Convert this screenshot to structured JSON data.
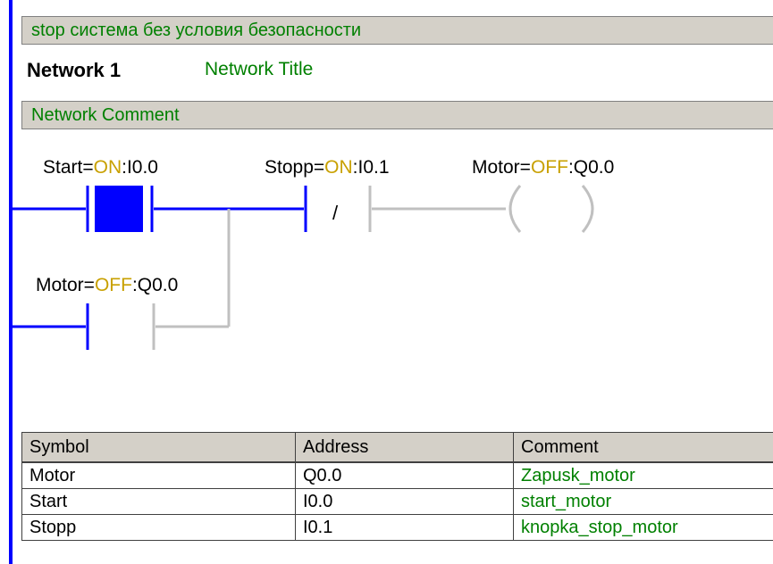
{
  "header": {
    "network_banner": "stop система без условия безопасности",
    "network_label": "Network 1",
    "network_title": "Network Title",
    "network_comment": "Network Comment"
  },
  "ladder": {
    "contact_start": {
      "symbol": "Start=",
      "state": "ON",
      "address": ":I0.0",
      "energized": true
    },
    "contact_stopp": {
      "symbol": "Stopp=",
      "state": "ON",
      "address": ":I0.1",
      "negated_glyph": "/"
    },
    "coil_motor": {
      "symbol": "Motor=",
      "state": "OFF",
      "address": ":Q0.0"
    },
    "contact_motor": {
      "symbol": "Motor=",
      "state": "OFF",
      "address": ":Q0.0"
    },
    "colors": {
      "powered": "#0000ff",
      "unpowered": "#c0c0c0",
      "state_text": "#c8a000",
      "comment_text": "#008000"
    }
  },
  "symbol_table": {
    "headers": [
      "Symbol",
      "Address",
      "Comment"
    ],
    "rows": [
      {
        "symbol": "Motor",
        "address": "Q0.0",
        "comment": "Zapusk_motor"
      },
      {
        "symbol": "Start",
        "address": "I0.0",
        "comment": "start_motor"
      },
      {
        "symbol": "Stopp",
        "address": "I0.1",
        "comment": "knopka_stop_motor"
      }
    ]
  }
}
